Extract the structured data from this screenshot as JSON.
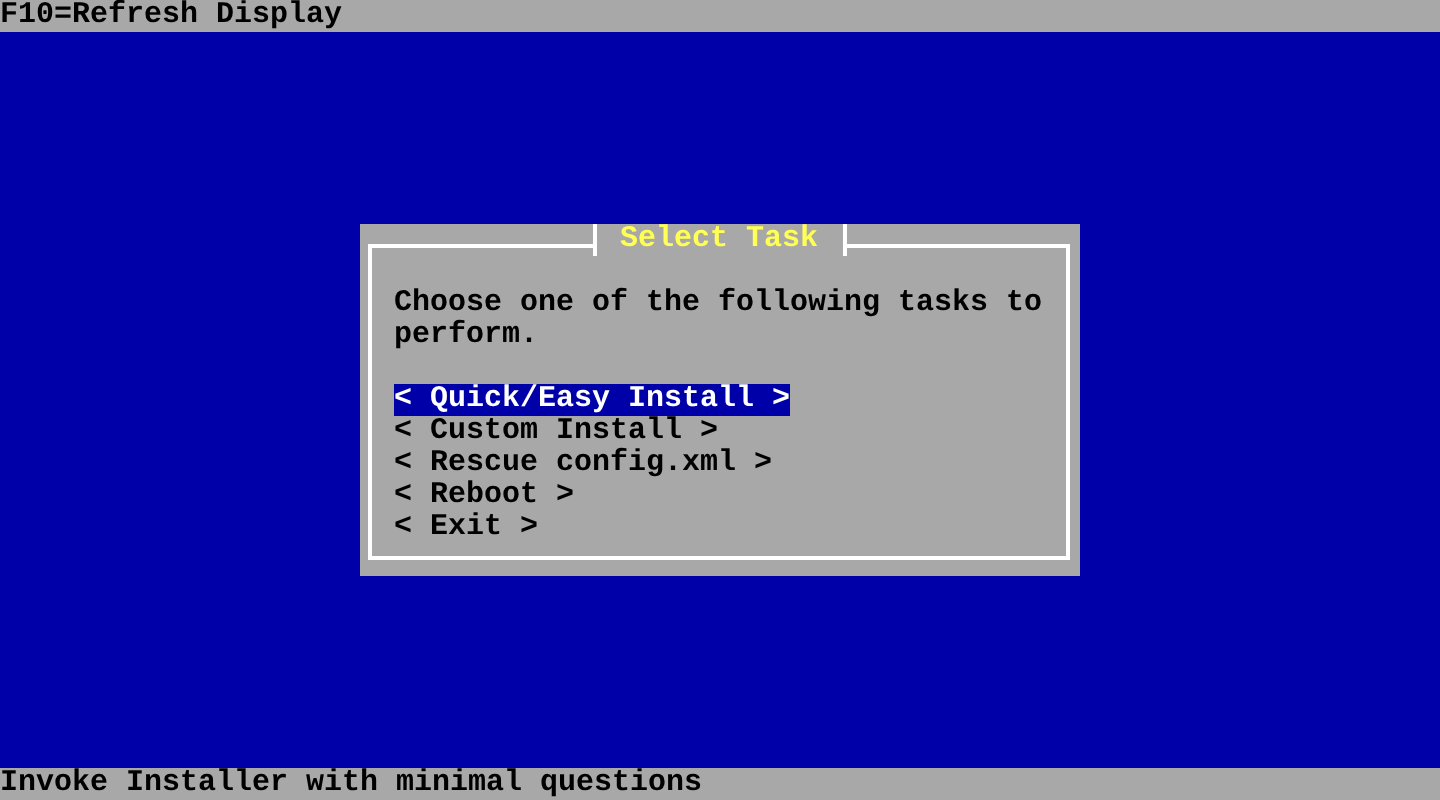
{
  "top_bar": {
    "text": "F10=Refresh Display"
  },
  "dialog": {
    "title": "Select Task",
    "prompt": "Choose one of the following tasks to perform.",
    "options": [
      {
        "label": "< Quick/Easy Install >",
        "selected": true
      },
      {
        "label": "< Custom Install >",
        "selected": false
      },
      {
        "label": "< Rescue config.xml >",
        "selected": false
      },
      {
        "label": "< Reboot >",
        "selected": false
      },
      {
        "label": "< Exit >",
        "selected": false
      }
    ]
  },
  "status_bar": {
    "text": "Invoke Installer with minimal questions"
  }
}
